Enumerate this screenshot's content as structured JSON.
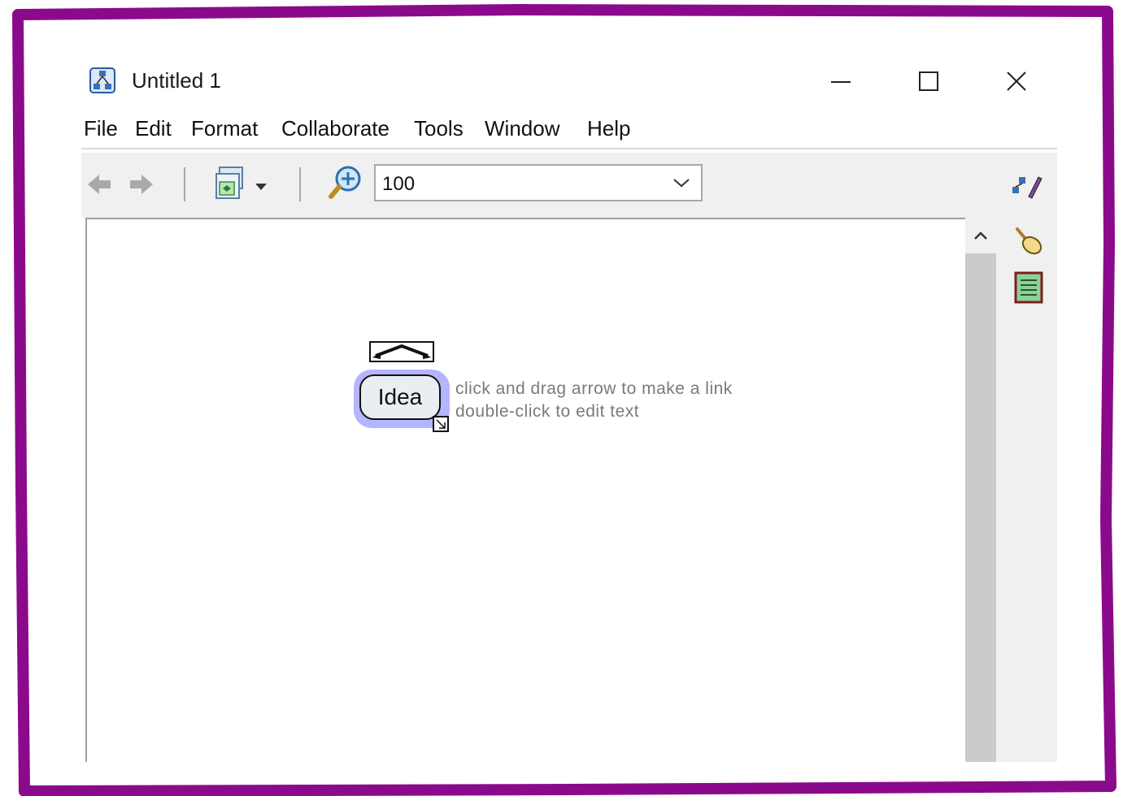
{
  "window": {
    "title": "Untitled 1"
  },
  "menu": [
    "File",
    "Edit",
    "Format",
    "Collaborate",
    "Tools",
    "Window",
    "Help"
  ],
  "toolbar": {
    "zoom_value": "100"
  },
  "canvas": {
    "node_label": "Idea",
    "hint_line1": "click and drag arrow to make a link",
    "hint_line2": "double-click to edit text"
  },
  "colors": {
    "frame": "#8b0a8b",
    "node_highlight": "#b5b5ff",
    "node_fill": "#e9eef3"
  },
  "icons": {
    "app": "concept-map-icon",
    "back": "back-arrow-icon",
    "forward": "forward-arrow-icon",
    "views": "views-icon",
    "zoom": "zoom-in-icon",
    "edit_style": "style-edit-icon",
    "format": "brush-icon",
    "info": "info-panel-icon"
  }
}
